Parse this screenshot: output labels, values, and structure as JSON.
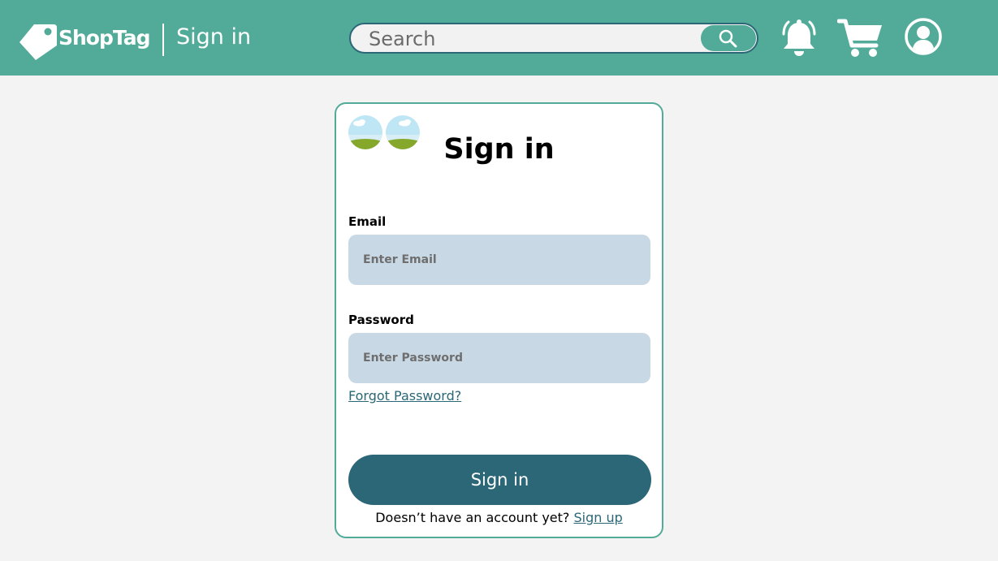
{
  "header": {
    "brand": "ShopTag",
    "page_label": "Sign in",
    "search": {
      "placeholder": "Search"
    }
  },
  "card": {
    "title": "Sign in",
    "email": {
      "label": "Email",
      "placeholder": "Enter Email"
    },
    "password": {
      "label": "Password",
      "placeholder": "Enter Password"
    },
    "forgot_link": "Forgot Password?",
    "submit_label": "Sign in",
    "signup_prompt": "Doesn’t have an account yet?",
    "signup_link": "Sign up"
  },
  "icons": {
    "logo": "tag-logo-icon",
    "search": "search-icon",
    "bell": "bell-icon",
    "cart": "cart-icon",
    "user": "user-icon",
    "image_placeholder": "image-placeholder-icon"
  },
  "colors": {
    "header_bg": "#52ab98",
    "primary": "#2b6777",
    "input_bg": "#c8d8e4",
    "page_bg": "#f3f3f3"
  }
}
